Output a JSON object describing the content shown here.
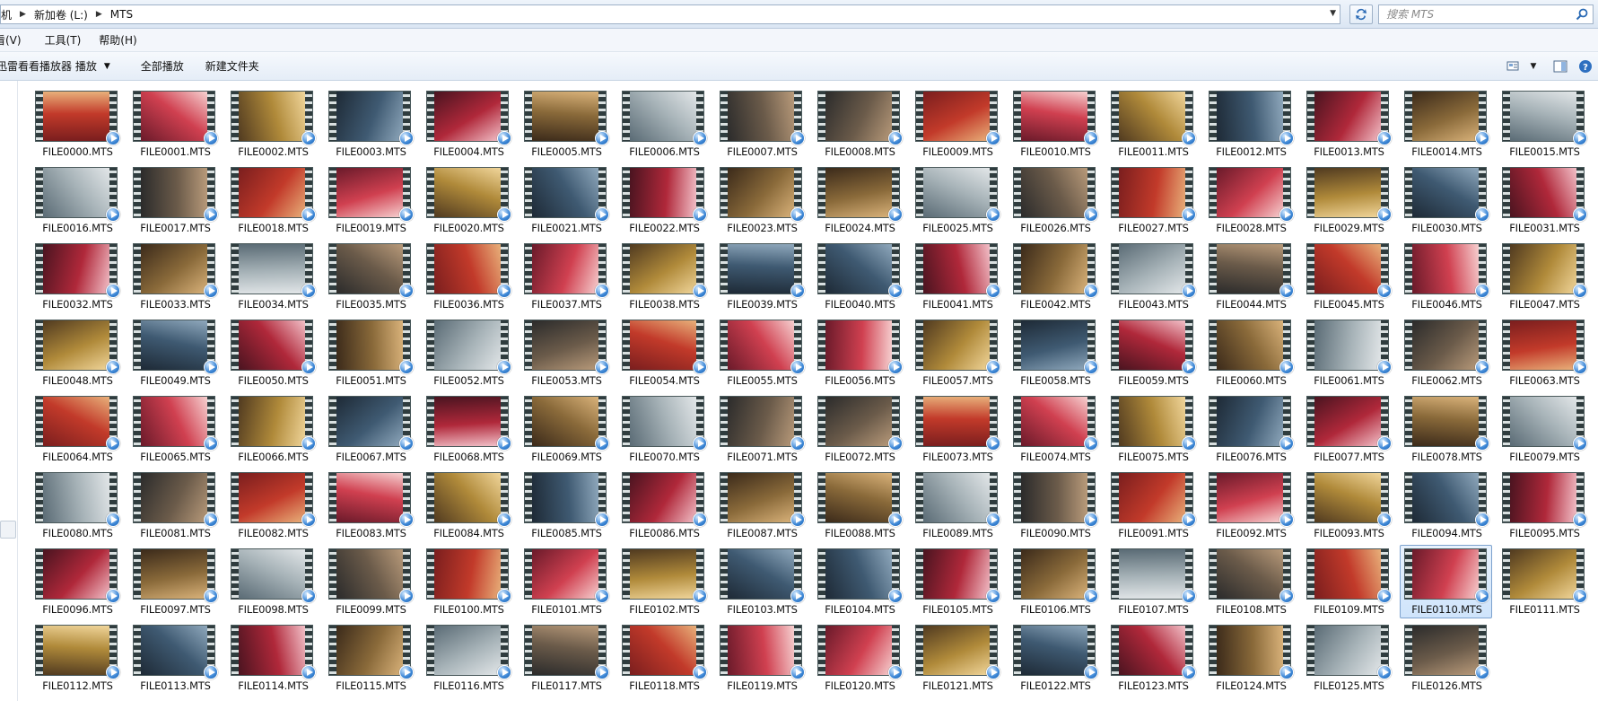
{
  "address": {
    "breadcrumbs": [
      "机",
      "新加卷 (L:)",
      "MTS"
    ],
    "search_placeholder": "搜索 MTS"
  },
  "menu": [
    "看(V)",
    "工具(T)",
    "帮助(H)"
  ],
  "toolbar": {
    "play_with": "迅雷看看播放器 播放",
    "play_all": "全部播放",
    "new_folder": "新建文件夹"
  },
  "colors": {
    "selection": "#cfe4fb",
    "accent": "#3b86d6"
  },
  "selected_file": "FILE0110.MTS",
  "files": [
    "FILE0000.MTS",
    "FILE0001.MTS",
    "FILE0002.MTS",
    "FILE0003.MTS",
    "FILE0004.MTS",
    "FILE0005.MTS",
    "FILE0006.MTS",
    "FILE0007.MTS",
    "FILE0008.MTS",
    "FILE0009.MTS",
    "FILE0010.MTS",
    "FILE0011.MTS",
    "FILE0012.MTS",
    "FILE0013.MTS",
    "FILE0014.MTS",
    "FILE0015.MTS",
    "FILE0016.MTS",
    "FILE0017.MTS",
    "FILE0018.MTS",
    "FILE0019.MTS",
    "FILE0020.MTS",
    "FILE0021.MTS",
    "FILE0022.MTS",
    "FILE0023.MTS",
    "FILE0024.MTS",
    "FILE0025.MTS",
    "FILE0026.MTS",
    "FILE0027.MTS",
    "FILE0028.MTS",
    "FILE0029.MTS",
    "FILE0030.MTS",
    "FILE0031.MTS",
    "FILE0032.MTS",
    "FILE0033.MTS",
    "FILE0034.MTS",
    "FILE0035.MTS",
    "FILE0036.MTS",
    "FILE0037.MTS",
    "FILE0038.MTS",
    "FILE0039.MTS",
    "FILE0040.MTS",
    "FILE0041.MTS",
    "FILE0042.MTS",
    "FILE0043.MTS",
    "FILE0044.MTS",
    "FILE0045.MTS",
    "FILE0046.MTS",
    "FILE0047.MTS",
    "FILE0048.MTS",
    "FILE0049.MTS",
    "FILE0050.MTS",
    "FILE0051.MTS",
    "FILE0052.MTS",
    "FILE0053.MTS",
    "FILE0054.MTS",
    "FILE0055.MTS",
    "FILE0056.MTS",
    "FILE0057.MTS",
    "FILE0058.MTS",
    "FILE0059.MTS",
    "FILE0060.MTS",
    "FILE0061.MTS",
    "FILE0062.MTS",
    "FILE0063.MTS",
    "FILE0064.MTS",
    "FILE0065.MTS",
    "FILE0066.MTS",
    "FILE0067.MTS",
    "FILE0068.MTS",
    "FILE0069.MTS",
    "FILE0070.MTS",
    "FILE0071.MTS",
    "FILE0072.MTS",
    "FILE0073.MTS",
    "FILE0074.MTS",
    "FILE0075.MTS",
    "FILE0076.MTS",
    "FILE0077.MTS",
    "FILE0078.MTS",
    "FILE0079.MTS",
    "FILE0080.MTS",
    "FILE0081.MTS",
    "FILE0082.MTS",
    "FILE0083.MTS",
    "FILE0084.MTS",
    "FILE0085.MTS",
    "FILE0086.MTS",
    "FILE0087.MTS",
    "FILE0088.MTS",
    "FILE0089.MTS",
    "FILE0090.MTS",
    "FILE0091.MTS",
    "FILE0092.MTS",
    "FILE0093.MTS",
    "FILE0094.MTS",
    "FILE0095.MTS",
    "FILE0096.MTS",
    "FILE0097.MTS",
    "FILE0098.MTS",
    "FILE0099.MTS",
    "FILE0100.MTS",
    "FILE0101.MTS",
    "FILE0102.MTS",
    "FILE0103.MTS",
    "FILE0104.MTS",
    "FILE0105.MTS",
    "FILE0106.MTS",
    "FILE0107.MTS",
    "FILE0108.MTS",
    "FILE0109.MTS",
    "FILE0110.MTS",
    "FILE0111.MTS",
    "FILE0112.MTS",
    "FILE0113.MTS",
    "FILE0114.MTS",
    "FILE0115.MTS",
    "FILE0116.MTS",
    "FILE0117.MTS",
    "FILE0118.MTS",
    "FILE0119.MTS",
    "FILE0120.MTS",
    "FILE0121.MTS",
    "FILE0122.MTS",
    "FILE0123.MTS",
    "FILE0124.MTS",
    "FILE0125.MTS",
    "FILE0126.MTS"
  ]
}
